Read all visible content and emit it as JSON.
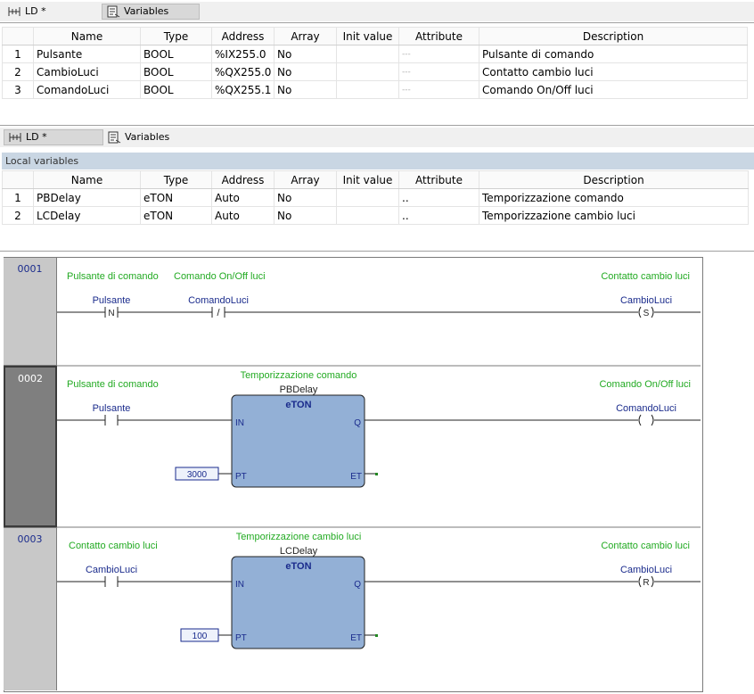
{
  "top_tabs": {
    "ld": "LD *",
    "variables": "Variables"
  },
  "global_table": {
    "headers": [
      "",
      "Name",
      "Type",
      "Address",
      "Array",
      "Init value",
      "Attribute",
      "Description"
    ],
    "rows": [
      {
        "n": "1",
        "name": "Pulsante",
        "type": "BOOL",
        "address": "%IX255.0",
        "array": "No",
        "init": "",
        "attr": "---",
        "desc": "Pulsante di comando"
      },
      {
        "n": "2",
        "name": "CambioLuci",
        "type": "BOOL",
        "address": "%QX255.0",
        "array": "No",
        "init": "",
        "attr": "---",
        "desc": "Contatto cambio luci"
      },
      {
        "n": "3",
        "name": "ComandoLuci",
        "type": "BOOL",
        "address": "%QX255.1",
        "array": "No",
        "init": "",
        "attr": "---",
        "desc": "Comando On/Off luci"
      }
    ]
  },
  "second_tabs": {
    "ld": "LD *",
    "variables": "Variables"
  },
  "local_header": "Local variables",
  "local_table": {
    "headers": [
      "",
      "Name",
      "Type",
      "Address",
      "Array",
      "Init value",
      "Attribute",
      "Description"
    ],
    "rows": [
      {
        "n": "1",
        "name": "PBDelay",
        "type": "eTON",
        "address": "Auto",
        "array": "No",
        "init": "",
        "attr": "..",
        "desc": "Temporizzazione comando"
      },
      {
        "n": "2",
        "name": "LCDelay",
        "type": "eTON",
        "address": "Auto",
        "array": "No",
        "init": "",
        "attr": "..",
        "desc": "Temporizzazione cambio luci"
      }
    ]
  },
  "ladder": {
    "rung1": {
      "num": "0001",
      "c1_comment": "Pulsante di comando",
      "c1_var": "Pulsante",
      "c1_sym": "N",
      "c2_comment": "Comando On/Off luci",
      "c2_var": "ComandoLuci",
      "c2_sym": "/",
      "coil_comment": "Contatto cambio luci",
      "coil_var": "CambioLuci",
      "coil_sym": "S"
    },
    "rung2": {
      "num": "0002",
      "c1_comment": "Pulsante di comando",
      "c1_var": "Pulsante",
      "fb_comment": "Temporizzazione comando",
      "fb_instance": "PBDelay",
      "fb_type": "eTON",
      "in_pin": "IN",
      "q_pin": "Q",
      "pt_pin": "PT",
      "et_pin": "ET",
      "pt_value": "3000",
      "coil_comment": "Comando On/Off luci",
      "coil_var": "ComandoLuci",
      "coil_sym": ""
    },
    "rung3": {
      "num": "0003",
      "c1_comment": "Contatto cambio luci",
      "c1_var": "CambioLuci",
      "fb_comment": "Temporizzazione cambio luci",
      "fb_instance": "LCDelay",
      "fb_type": "eTON",
      "in_pin": "IN",
      "q_pin": "Q",
      "pt_pin": "PT",
      "et_pin": "ET",
      "pt_value": "100",
      "coil_comment": "Contatto cambio luci",
      "coil_var": "CambioLuci",
      "coil_sym": "R"
    }
  },
  "colors": {
    "comment": "#22aa22",
    "varname": "#1a2b8c",
    "fb_fill": "#93b0d6",
    "gutter_selected": "#7f7f7f",
    "gutter": "#c8c8c8"
  }
}
